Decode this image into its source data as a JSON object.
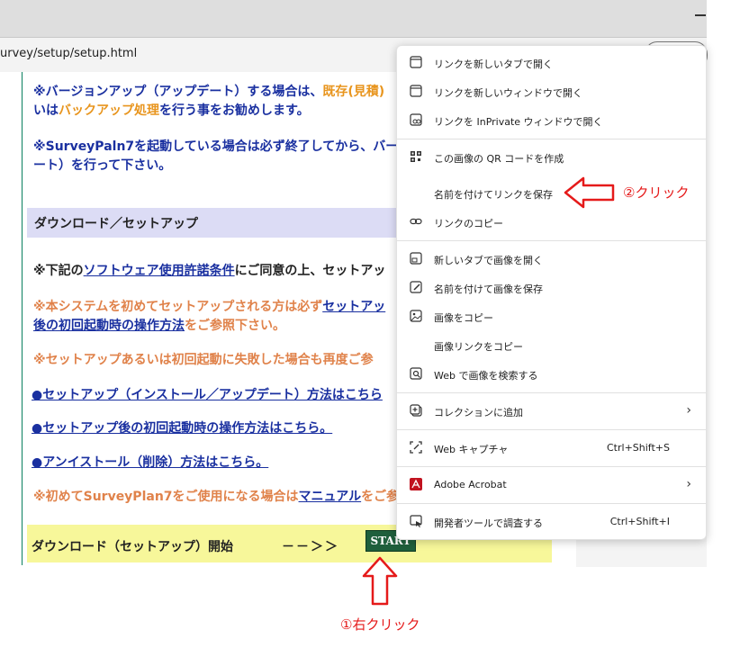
{
  "browser": {
    "url": "urvey/setup/setup.html"
  },
  "page": {
    "notice1_a": "※バージョンアップ（アップデート）する場合は、",
    "notice1_hl": "既存(見積)",
    "notice1_b": "いは",
    "notice1_hl2": "バックアップ処理",
    "notice1_c": "を行う事をお勧めします。",
    "notice2_a": "※SurveyPaln7を起動している場合は必ず終了してから、バー",
    "notice2_b": "ート）を行って下さい。",
    "section_header": "ダウンロード／セットアップ",
    "license_a": "※下記の",
    "license_link": "ソフトウェア使用許諾条件",
    "license_b": "にご同意の上、セットアッ",
    "first_setup_a": "※本システムを初めてセットアップされる方は必ず",
    "first_setup_link": "セットアッ",
    "first_setup_b": "後の初回起動時の操作方法",
    "first_setup_c": "をご参照下さい。",
    "fail_notice": "※セットアップあるいは初回起動に失敗した場合も再度ご参",
    "link_setup": "●セットアップ（インストール／アップデート）方法はこちら",
    "link_first_launch": "●セットアップ後の初回起動時の操作方法はこちら。",
    "link_uninstall": "●アンイストール（削除）方法はこちら。",
    "manual_a": "※初めてSurveyPlan7をご使用になる場合は",
    "manual_hl": "マニュアル",
    "manual_b": "をご参",
    "download_label": "ダウンロード（セットアップ）開始",
    "download_arrow": "－－＞＞",
    "start_button": "START"
  },
  "context_menu": {
    "items": [
      {
        "label": "リンクを新しいタブで開く",
        "icon": "new-tab-icon",
        "shortcut": ""
      },
      {
        "label": "リンクを新しいウィンドウで開く",
        "icon": "new-window-icon",
        "shortcut": ""
      },
      {
        "label": "リンクを InPrivate ウィンドウで開く",
        "icon": "inprivate-icon",
        "shortcut": ""
      },
      {
        "label": "この画像の QR コードを作成",
        "icon": "qr-code-icon",
        "shortcut": ""
      },
      {
        "label": "名前を付けてリンクを保存",
        "icon": "",
        "shortcut": ""
      },
      {
        "label": "リンクのコピー",
        "icon": "link-icon",
        "shortcut": ""
      },
      {
        "label": "新しいタブで画像を開く",
        "icon": "image-new-tab-icon",
        "shortcut": ""
      },
      {
        "label": "名前を付けて画像を保存",
        "icon": "save-image-icon",
        "shortcut": ""
      },
      {
        "label": "画像をコピー",
        "icon": "copy-image-icon",
        "shortcut": ""
      },
      {
        "label": "画像リンクをコピー",
        "icon": "",
        "shortcut": ""
      },
      {
        "label": "Web で画像を検索する",
        "icon": "image-search-icon",
        "shortcut": ""
      },
      {
        "label": "コレクションに追加",
        "icon": "collections-icon",
        "shortcut": ""
      },
      {
        "label": "Web キャプチャ",
        "icon": "web-capture-icon",
        "shortcut": "Ctrl+Shift+S"
      },
      {
        "label": "Adobe Acrobat",
        "icon": "acrobat-icon",
        "shortcut": ""
      },
      {
        "label": "開発者ツールで調査する",
        "icon": "devtools-icon",
        "shortcut": "Ctrl+Shift+I"
      }
    ]
  },
  "annotations": {
    "step1": "①右クリック",
    "step2": "②クリック",
    "arrow_color": "#e51a1a"
  }
}
